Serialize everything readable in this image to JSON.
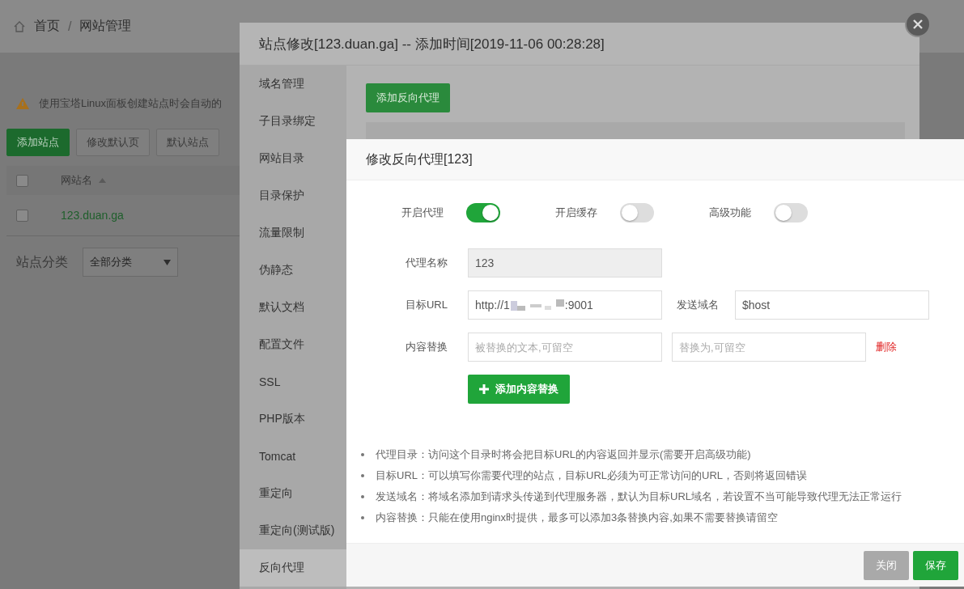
{
  "breadcrumb": {
    "home": "首页",
    "separator": "/",
    "current": "网站管理"
  },
  "notice": "使用宝塔Linux面板创建站点时会自动的",
  "site_buttons": [
    {
      "label": "添加站点",
      "kind": "primary"
    },
    {
      "label": "修改默认页",
      "kind": "default"
    },
    {
      "label": "默认站点",
      "kind": "default"
    }
  ],
  "site_table": {
    "select_all_checked": false,
    "columns": [
      {
        "label": "网站名",
        "sorted": true
      }
    ],
    "rows": [
      {
        "name": "123.duan.ga",
        "checked": false
      }
    ]
  },
  "category": {
    "label": "站点分类",
    "value": "全部分类"
  },
  "site_dialog": {
    "title": "站点修改[123.duan.ga] -- 添加时间[2019-11-06 00:28:28]",
    "menu": [
      {
        "label": "域名管理",
        "selected": false
      },
      {
        "label": "子目录绑定",
        "selected": false
      },
      {
        "label": "网站目录",
        "selected": false
      },
      {
        "label": "目录保护",
        "selected": false
      },
      {
        "label": "流量限制",
        "selected": false
      },
      {
        "label": "伪静态",
        "selected": false
      },
      {
        "label": "默认文档",
        "selected": false
      },
      {
        "label": "配置文件",
        "selected": false
      },
      {
        "label": "SSL",
        "selected": false
      },
      {
        "label": "PHP版本",
        "selected": false
      },
      {
        "label": "Tomcat",
        "selected": false
      },
      {
        "label": "重定向",
        "selected": false
      },
      {
        "label": "重定向(测试版)",
        "selected": false
      },
      {
        "label": "反向代理",
        "selected": true
      }
    ],
    "add_button": "添加反向代理"
  },
  "proxy_dialog": {
    "title": "修改反向代理[123]",
    "toggles": [
      {
        "label": "开启代理",
        "on": true
      },
      {
        "label": "开启缓存",
        "on": false
      },
      {
        "label": "高级功能",
        "on": false
      }
    ],
    "proxy_name": {
      "label": "代理名称",
      "value": "123",
      "disabled": true
    },
    "target_url": {
      "label": "目标URL",
      "value_start": "http://1",
      "value_end": ":9001"
    },
    "send_domain": {
      "label": "发送域名",
      "value": "$host"
    },
    "content_replace": {
      "label": "内容替换",
      "from_placeholder": "被替换的文本,可留空",
      "to_placeholder": "替换为,可留空",
      "delete": "删除"
    },
    "add_replace_button": "添加内容替换",
    "tips": [
      "代理目录：访问这个目录时将会把目标URL的内容返回并显示(需要开启高级功能)",
      "目标URL：可以填写你需要代理的站点，目标URL必须为可正常访问的URL，否则将返回错误",
      "发送域名：将域名添加到请求头传递到代理服务器，默认为目标URL域名，若设置不当可能导致代理无法正常运行",
      "内容替换：只能在使用nginx时提供，最多可以添加3条替换内容,如果不需要替换请留空"
    ],
    "buttons": [
      {
        "label": "关闭",
        "kind": "close"
      },
      {
        "label": "保存",
        "kind": "save"
      }
    ]
  }
}
